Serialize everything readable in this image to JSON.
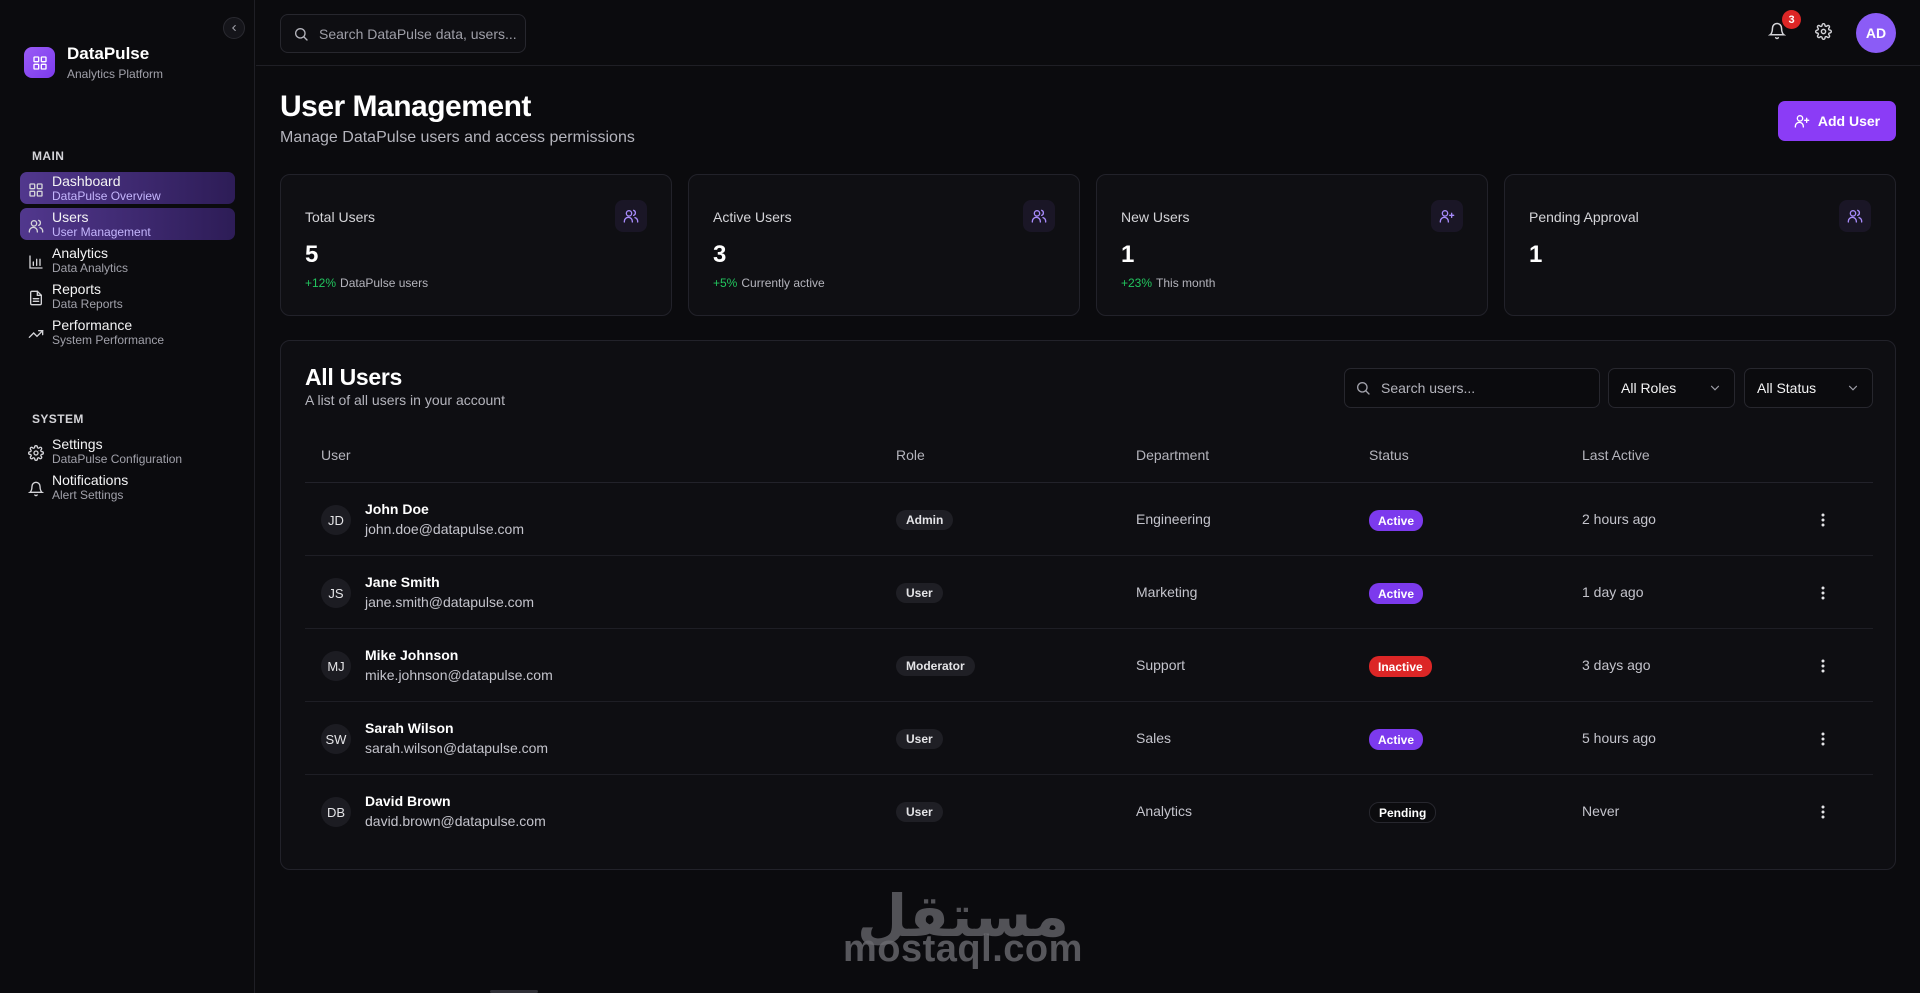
{
  "brand": {
    "name": "DataPulse",
    "subtitle": "Analytics Platform"
  },
  "sidebar": {
    "main_label": "MAIN",
    "main_items": [
      {
        "label": "Dashboard",
        "sub": "DataPulse Overview",
        "icon": "grid-icon",
        "active": true
      },
      {
        "label": "Users",
        "sub": "User Management",
        "icon": "users-icon",
        "active": true
      },
      {
        "label": "Analytics",
        "sub": "Data Analytics",
        "icon": "bar-chart-icon",
        "active": false
      },
      {
        "label": "Reports",
        "sub": "Data Reports",
        "icon": "file-icon",
        "active": false
      },
      {
        "label": "Performance",
        "sub": "System Performance",
        "icon": "trending-up-icon",
        "active": false
      }
    ],
    "system_label": "SYSTEM",
    "system_items": [
      {
        "label": "Settings",
        "sub": "DataPulse Configuration",
        "icon": "gear-icon"
      },
      {
        "label": "Notifications",
        "sub": "Alert Settings",
        "icon": "bell-icon"
      }
    ]
  },
  "topbar": {
    "search_placeholder": "Search DataPulse data, users...",
    "notification_count": "3",
    "avatar_initials": "AD"
  },
  "header": {
    "title": "User Management",
    "subtitle": "Manage DataPulse users and access permissions",
    "add_user_label": "Add User"
  },
  "stats": [
    {
      "label": "Total Users",
      "value": "5",
      "delta": "+12%",
      "note": "DataPulse users",
      "icon": "users-icon"
    },
    {
      "label": "Active Users",
      "value": "3",
      "delta": "+5%",
      "note": "Currently active",
      "icon": "users-icon"
    },
    {
      "label": "New Users",
      "value": "1",
      "delta": "+23%",
      "note": "This month",
      "icon": "user-plus-icon"
    },
    {
      "label": "Pending Approval",
      "value": "1",
      "delta": "",
      "note": "",
      "icon": "users-icon"
    }
  ],
  "users_panel": {
    "title": "All Users",
    "subtitle": "A list of all users in your account",
    "search_placeholder": "Search users...",
    "role_filter": "All Roles",
    "status_filter": "All Status",
    "columns": [
      "User",
      "Role",
      "Department",
      "Status",
      "Last Active"
    ],
    "rows": [
      {
        "initials": "JD",
        "name": "John Doe",
        "email": "john.doe@datapulse.com",
        "role": "Admin",
        "department": "Engineering",
        "status": "Active",
        "last_active": "2 hours ago"
      },
      {
        "initials": "JS",
        "name": "Jane Smith",
        "email": "jane.smith@datapulse.com",
        "role": "User",
        "department": "Marketing",
        "status": "Active",
        "last_active": "1 day ago"
      },
      {
        "initials": "MJ",
        "name": "Mike Johnson",
        "email": "mike.johnson@datapulse.com",
        "role": "Moderator",
        "department": "Support",
        "status": "Inactive",
        "last_active": "3 days ago"
      },
      {
        "initials": "SW",
        "name": "Sarah Wilson",
        "email": "sarah.wilson@datapulse.com",
        "role": "User",
        "department": "Sales",
        "status": "Active",
        "last_active": "5 hours ago"
      },
      {
        "initials": "DB",
        "name": "David Brown",
        "email": "david.brown@datapulse.com",
        "role": "User",
        "department": "Analytics",
        "status": "Pending",
        "last_active": "Never"
      }
    ]
  },
  "watermark": {
    "text_latin": "mostaql.com",
    "text_arabic": "مستقل"
  },
  "colors": {
    "accent": "#8b5cf6",
    "success": "#22c55e",
    "danger": "#dc2626",
    "background": "#0b0b0e"
  }
}
